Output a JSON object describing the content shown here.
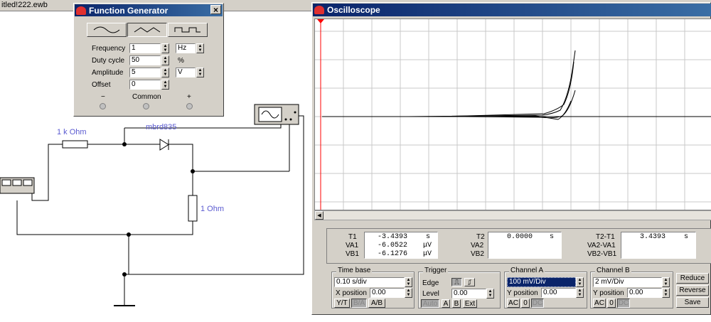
{
  "schematic": {
    "file_title": "itled!222.ewb",
    "resistor_label": "1 k Ohm",
    "diode_label": "mbrd835",
    "load_label": "1  Ohm"
  },
  "function_generator": {
    "title": "Function Generator",
    "close_label": "×",
    "waveforms": [
      "sine-wave",
      "triangle-wave",
      "square-wave"
    ],
    "selected_waveform": "triangle-wave",
    "frequency_label": "Frequency",
    "frequency_value": "1",
    "frequency_unit": "Hz",
    "duty_label": "Duty cycle",
    "duty_value": "50",
    "duty_unit": "%",
    "amplitude_label": "Amplitude",
    "amplitude_value": "5",
    "amplitude_unit": "V",
    "offset_label": "Offset",
    "offset_value": "0",
    "minus": "−",
    "common": "Common",
    "plus": "+"
  },
  "oscilloscope": {
    "title": "Oscilloscope",
    "readouts": {
      "t1_label": "T1",
      "t1_value": "-3.4393",
      "t1_unit": "s",
      "va1_label": "VA1",
      "va1_value": "-6.0522",
      "va1_unit": "μV",
      "vb1_label": "VB1",
      "vb1_value": "-6.1276",
      "vb1_unit": "μV",
      "t2_label": "T2",
      "t2_value": "0.0000",
      "t2_unit": "s",
      "va2_label": "VA2",
      "vb2_label": "VB2",
      "dt_label": "T2-T1",
      "dt_value": "3.4393",
      "dt_unit": "s",
      "dva_label": "VA2-VA1",
      "dvb_label": "VB2-VB1"
    },
    "time_base": {
      "title": "Time base",
      "value": "0.10 s/div",
      "xpos_label": "X position",
      "xpos_value": "0.00",
      "yt": "Y/T",
      "ba": "B/A",
      "avb": "A/B"
    },
    "trigger": {
      "title": "Trigger",
      "edge_label": "Edge",
      "level_label": "Level",
      "level_value": "0.00",
      "auto": "Auto",
      "a": "A",
      "b": "B",
      "ext": "Ext"
    },
    "channel_a": {
      "title": "Channel A",
      "value": "100 mV/Div",
      "ypos_label": "Y position",
      "ypos_value": "0.00",
      "ac": "AC",
      "zero": "0",
      "dc": "DC"
    },
    "channel_b": {
      "title": "Channel B",
      "value": "2 mV/Div",
      "ypos_label": "Y position",
      "ypos_value": "0.00",
      "ac": "AC",
      "zero": "0",
      "dc": "DC"
    },
    "buttons": {
      "reduce": "Reduce",
      "reverse": "Reverse",
      "save": "Save"
    }
  },
  "colors": {
    "wire": "#000000",
    "label_blue": "#5a5ad0",
    "title_start": "#0a246a",
    "title_end": "#3a6ea5",
    "cursor_red": "#ff0000"
  }
}
